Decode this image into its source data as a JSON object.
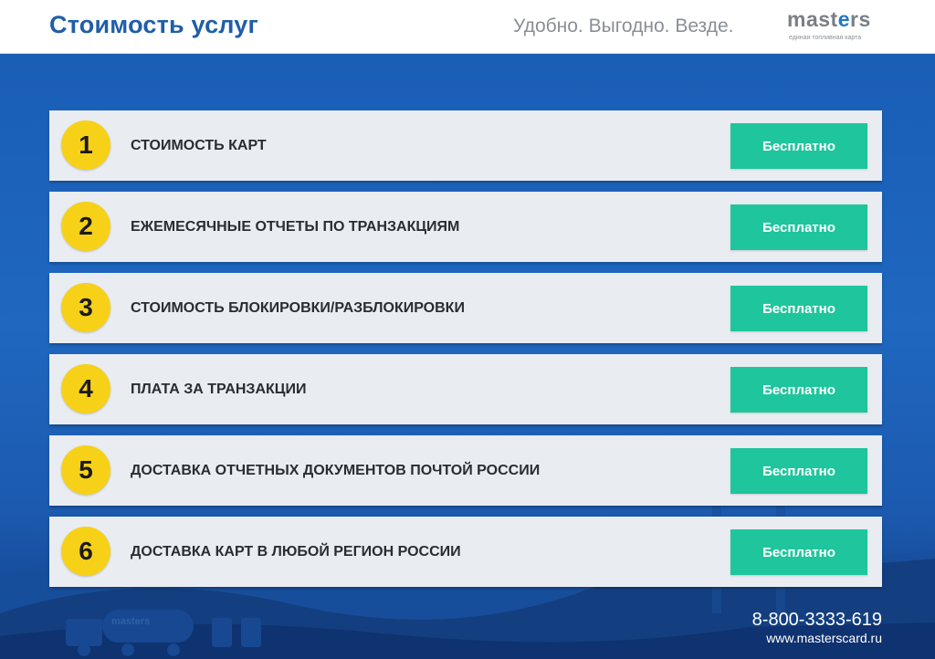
{
  "header": {
    "title": "Стоимость услуг",
    "slogan": "Удобно. Выгодно. Везде.",
    "logo_word_a": "mast",
    "logo_word_b": "e",
    "logo_word_c": "rs",
    "logo_subtitle": "единая топливная карта"
  },
  "services": [
    {
      "number": "1",
      "label": "СТОИМОСТЬ КАРТ",
      "price": "Бесплатно"
    },
    {
      "number": "2",
      "label": "ЕЖЕМЕСЯЧНЫЕ ОТЧЕТЫ ПО ТРАНЗАКЦИЯМ",
      "price": "Бесплатно"
    },
    {
      "number": "3",
      "label": "СТОИМОСТЬ БЛОКИРОВКИ/РАЗБЛОКИРОВКИ",
      "price": "Бесплатно"
    },
    {
      "number": "4",
      "label": "ПЛАТА ЗА ТРАНЗАКЦИИ",
      "price": "Бесплатно"
    },
    {
      "number": "5",
      "label": "ДОСТАВКА ОТЧЕТНЫХ ДОКУМЕНТОВ ПОЧТОЙ РОССИИ",
      "price": "Бесплатно"
    },
    {
      "number": "6",
      "label": "ДОСТАВКА КАРТ В ЛЮБОЙ РЕГИОН РОССИИ",
      "price": "Бесплатно"
    }
  ],
  "footer": {
    "phone": "8-800-3333-619",
    "website": "www.masterscard.ru",
    "truck_text": "masters"
  },
  "colors": {
    "brand_blue": "#1f5ea8",
    "number_badge": "#f7d117",
    "price_badge": "#1fc59c",
    "background": "#1b5cb0"
  }
}
